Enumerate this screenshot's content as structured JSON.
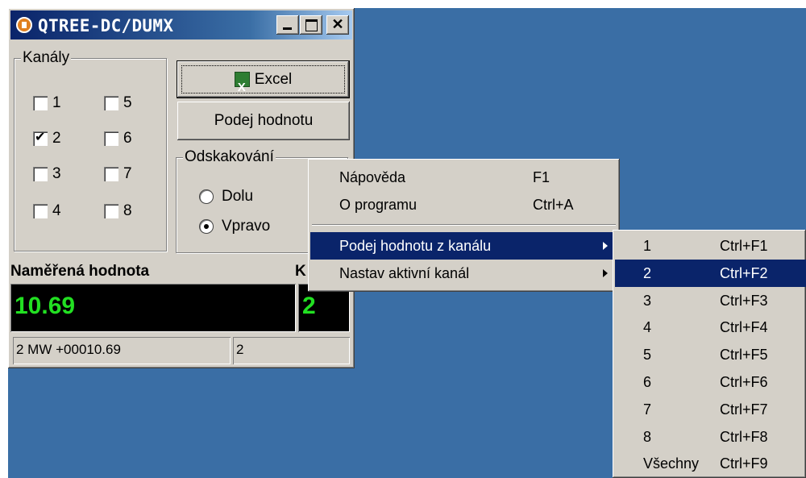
{
  "window": {
    "title": "QTREE-DC/DUMX",
    "buttons": {
      "minimize": "",
      "maximize": "",
      "close": "✕"
    }
  },
  "kanaly": {
    "label": "Kanály",
    "channels": [
      {
        "label": "1",
        "checked": false
      },
      {
        "label": "2",
        "checked": true
      },
      {
        "label": "3",
        "checked": false
      },
      {
        "label": "4",
        "checked": false
      },
      {
        "label": "5",
        "checked": false
      },
      {
        "label": "6",
        "checked": false
      },
      {
        "label": "7",
        "checked": false
      },
      {
        "label": "8",
        "checked": false
      }
    ]
  },
  "buttons": {
    "excel": "Excel",
    "podej_hodnotu": "Podej hodnotu"
  },
  "odskakovani": {
    "label": "Odskakování",
    "options": [
      {
        "label": "Dolu",
        "selected": false
      },
      {
        "label": "Vpravo",
        "selected": true
      }
    ]
  },
  "measure": {
    "label": "Naměřená hodnota",
    "channel_label": "K",
    "value": "10.69",
    "channel": "2"
  },
  "status": {
    "raw": "2 MW +00010.69",
    "channel": "2"
  },
  "context_menu": {
    "items": [
      {
        "label": "Nápověda",
        "shortcut": "F1"
      },
      {
        "label": "O programu",
        "shortcut": "Ctrl+A"
      },
      {
        "label": "Podej hodnotu z kanálu",
        "shortcut": "",
        "submenu": true,
        "highlighted": true
      },
      {
        "label": "Nastav aktivní kanál",
        "shortcut": "",
        "submenu": true
      }
    ]
  },
  "submenu": {
    "items": [
      {
        "label": "1",
        "shortcut": "Ctrl+F1"
      },
      {
        "label": "2",
        "shortcut": "Ctrl+F2",
        "highlighted": true
      },
      {
        "label": "3",
        "shortcut": "Ctrl+F3"
      },
      {
        "label": "4",
        "shortcut": "Ctrl+F4"
      },
      {
        "label": "5",
        "shortcut": "Ctrl+F5"
      },
      {
        "label": "6",
        "shortcut": "Ctrl+F6"
      },
      {
        "label": "7",
        "shortcut": "Ctrl+F7"
      },
      {
        "label": "8",
        "shortcut": "Ctrl+F8"
      },
      {
        "label": "Všechny",
        "shortcut": "Ctrl+F9"
      }
    ]
  },
  "colors": {
    "desktop": "#3a6ea5",
    "highlight": "#0a246a",
    "lcd_text": "#22e022"
  }
}
